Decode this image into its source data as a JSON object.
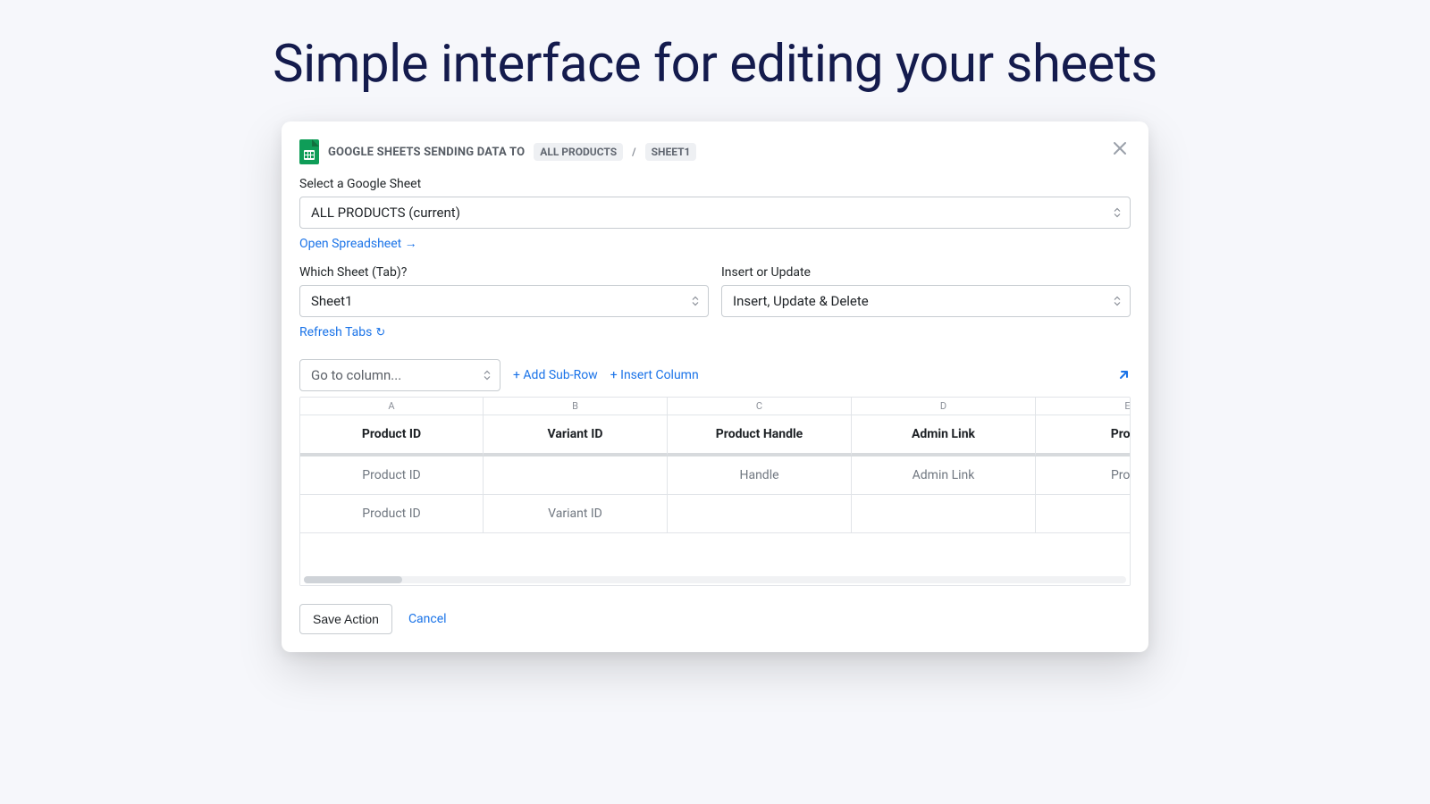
{
  "headline": "Simple interface for editing your sheets",
  "header": {
    "prefix": "GOOGLE SHEETS SENDING DATA TO",
    "spreadsheet_pill": "ALL PRODUCTS",
    "tab_pill": "SHEET1"
  },
  "fields": {
    "select_sheet_label": "Select a Google Sheet",
    "select_sheet_value": "ALL PRODUCTS (current)",
    "open_spreadsheet_link": "Open Spreadsheet →",
    "which_tab_label": "Which Sheet (Tab)?",
    "which_tab_value": "Sheet1",
    "refresh_tabs_link": "Refresh Tabs",
    "insert_update_label": "Insert or Update",
    "insert_update_value": "Insert, Update & Delete"
  },
  "toolbar": {
    "goto_column_placeholder": "Go to column...",
    "add_subrow_link": "+ Add Sub-Row",
    "insert_column_link": "+ Insert Column"
  },
  "grid": {
    "column_letters": [
      "A",
      "B",
      "C",
      "D",
      "E"
    ],
    "headers": [
      "Product ID",
      "Variant ID",
      "Product Handle",
      "Admin Link",
      "Produ"
    ],
    "rows": [
      [
        "Product ID",
        "",
        "Handle",
        "Admin Link",
        "Produ"
      ],
      [
        "Product ID",
        "Variant ID",
        "",
        "",
        ""
      ]
    ]
  },
  "footer": {
    "save_label": "Save Action",
    "cancel_label": "Cancel"
  }
}
